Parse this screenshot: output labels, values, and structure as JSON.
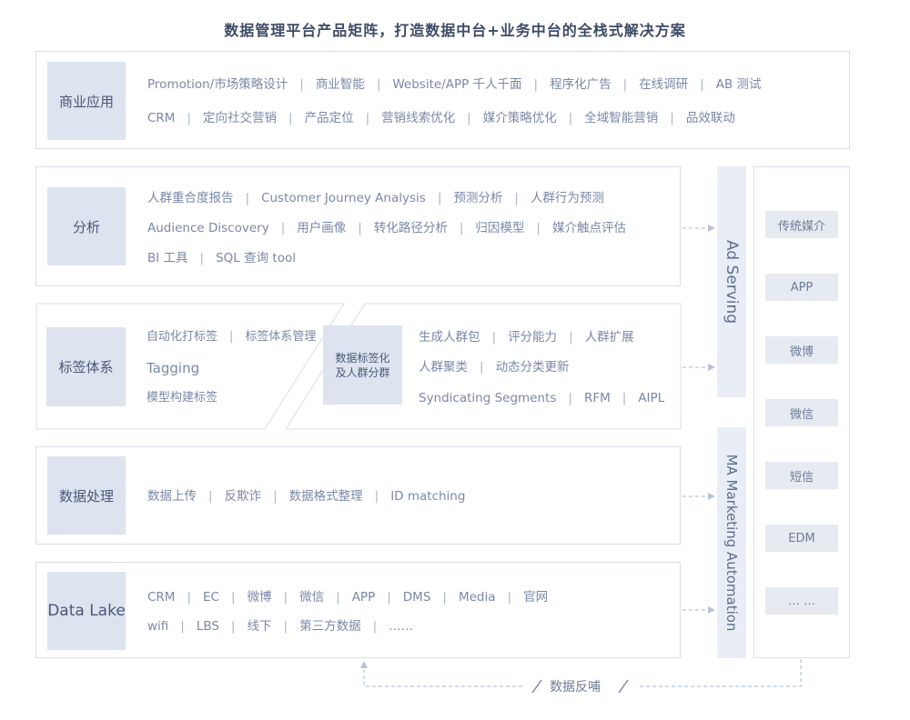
{
  "title": "数据管理平台产品矩阵，打造数据中台+业务中台的全栈式解决方案",
  "layers": {
    "business": {
      "label": "商业应用",
      "row1": [
        "Promotion/市场策略设计",
        "商业智能",
        "Website/APP 千人千面",
        "程序化广告",
        "在线调研",
        "AB 测试"
      ],
      "row2": [
        "CRM",
        "定向社交营销",
        "产品定位",
        "营销线索优化",
        "媒介策略优化",
        "全域智能营销",
        "品效联动"
      ]
    },
    "analysis": {
      "label": "分析",
      "row1": [
        "人群重合度报告",
        "Customer Journey Analysis",
        "预测分析",
        "人群行为预测"
      ],
      "row2": [
        "Audience Discovery",
        "用户画像",
        "转化路径分析",
        "归因模型",
        "媒介触点评估"
      ],
      "row3": [
        "BI 工具",
        "SQL 查询 tool"
      ]
    },
    "tagging": {
      "label": "标签体系",
      "row1": [
        "自动化打标签",
        "标签体系管理"
      ],
      "row2": [
        "Tagging"
      ],
      "row3": [
        "模型构建标签"
      ],
      "mid_label": "数据标签化及人群分群",
      "right_row1": [
        "生成人群包",
        "评分能力",
        "人群扩展"
      ],
      "right_row2": [
        "人群聚类",
        "动态分类更新"
      ],
      "right_row3": [
        "Syndicating Segments",
        "RFM",
        "AIPL"
      ]
    },
    "processing": {
      "label": "数据处理",
      "row1": [
        "数据上传",
        "反欺诈",
        "数据格式整理",
        "ID matching"
      ]
    },
    "datalake": {
      "label": "Data Lake",
      "row1": [
        "CRM",
        "EC",
        "微博",
        "微信",
        "APP",
        "DMS",
        "Media",
        "官网"
      ],
      "row2": [
        "wifi",
        "LBS",
        "线下",
        "第三方数据",
        "……"
      ]
    }
  },
  "ad_serving": "Ad Serving",
  "ma": "MA Marketing Automation",
  "channels": [
    "传统媒介",
    "APP",
    "微博",
    "微信",
    "短信",
    "EDM",
    "… …"
  ],
  "feedback": "数据反哺",
  "colors": {
    "panel_border": "#d8dee8",
    "label_bg": "#dde3ef",
    "side_bar_bg": "#e8edf6",
    "text": "#7a88a6"
  }
}
